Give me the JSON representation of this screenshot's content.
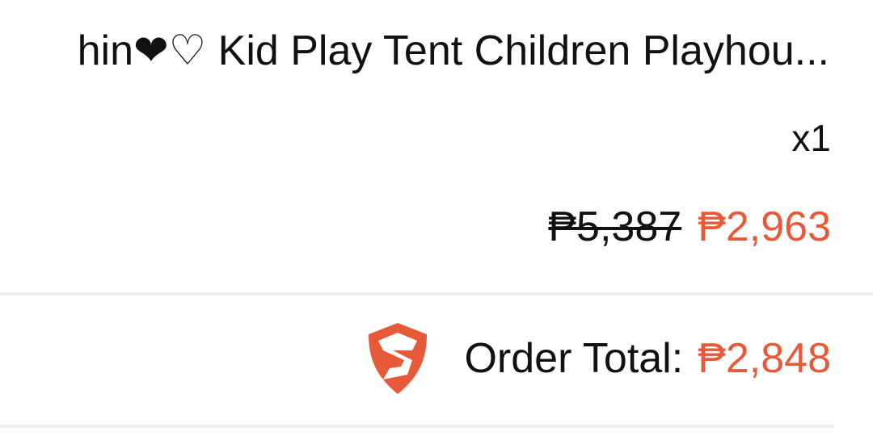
{
  "product": {
    "title": "hin❤♡ Kid Play Tent Children Playhou...",
    "quantity": "x1",
    "original_price": "₱5,387",
    "sale_price": "₱2,963"
  },
  "summary": {
    "icon": "shield-icon",
    "label": "Order Total:",
    "total": "₱2,848"
  },
  "colors": {
    "accent": "#e65a3a",
    "text": "#111111",
    "divider": "#eeeeee",
    "background": "#ffffff"
  }
}
